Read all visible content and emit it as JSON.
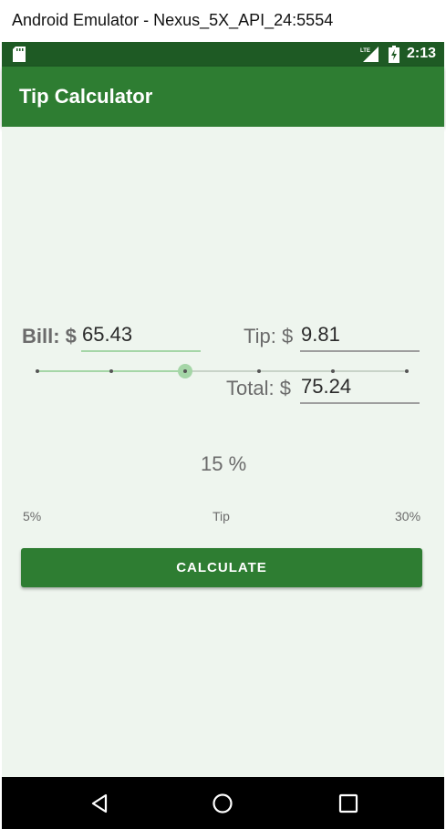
{
  "window": {
    "title": "Android Emulator - Nexus_5X_API_24:5554"
  },
  "status_bar": {
    "time": "2:13",
    "network_label": "LTE",
    "icons": [
      "sd-card-icon",
      "lte-signal-icon",
      "battery-charging-icon"
    ]
  },
  "app_bar": {
    "title": "Tip Calculator"
  },
  "form": {
    "bill_label": "Bill: $",
    "bill_value": "65.43",
    "tip_label": "Tip: $",
    "tip_value": "9.81",
    "total_label": "Total: $",
    "total_value": "75.24"
  },
  "tip_slider": {
    "percent_text": "15 %",
    "value": 15,
    "min": 5,
    "max": 30,
    "step": 5,
    "min_label": "5%",
    "max_label": "30%",
    "caption": "Tip"
  },
  "calculate_button": {
    "label": "CALCULATE"
  },
  "nav_bar": {
    "icons": [
      "back-icon",
      "home-icon",
      "recents-icon"
    ]
  },
  "colors": {
    "primary": "#2e7d32",
    "primary_dark": "#1e5a24",
    "accent_light": "#a5d6a7",
    "background": "#eef5ee"
  }
}
